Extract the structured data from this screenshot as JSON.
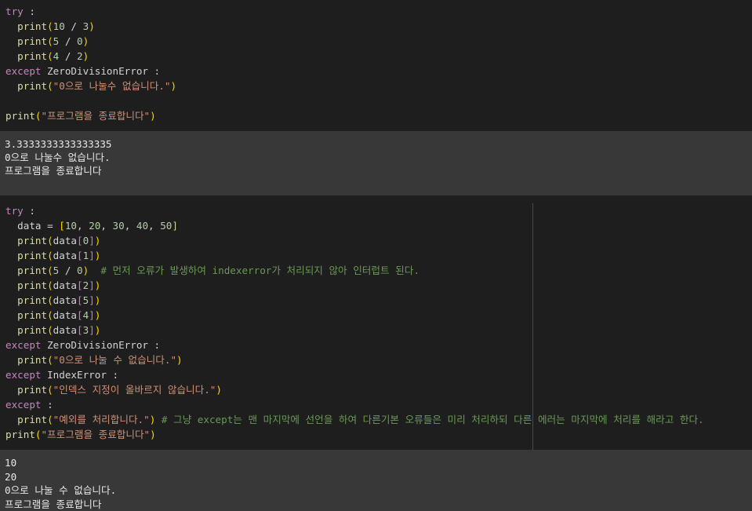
{
  "cell1": {
    "code": [
      [
        {
          "t": "try",
          "c": "kw"
        },
        {
          "t": " :",
          "c": "pl"
        }
      ],
      [
        {
          "t": "  print",
          "c": "fn"
        },
        {
          "t": "(",
          "c": "br"
        },
        {
          "t": "10",
          "c": "num"
        },
        {
          "t": " / ",
          "c": "pl"
        },
        {
          "t": "3",
          "c": "num"
        },
        {
          "t": ")",
          "c": "br"
        }
      ],
      [
        {
          "t": "  print",
          "c": "fn"
        },
        {
          "t": "(",
          "c": "br"
        },
        {
          "t": "5",
          "c": "num"
        },
        {
          "t": " / ",
          "c": "pl"
        },
        {
          "t": "0",
          "c": "num"
        },
        {
          "t": ")",
          "c": "br"
        }
      ],
      [
        {
          "t": "  print",
          "c": "fn"
        },
        {
          "t": "(",
          "c": "br"
        },
        {
          "t": "4",
          "c": "num"
        },
        {
          "t": " / ",
          "c": "pl"
        },
        {
          "t": "2",
          "c": "num"
        },
        {
          "t": ")",
          "c": "br"
        }
      ],
      [
        {
          "t": "except",
          "c": "kw"
        },
        {
          "t": " ZeroDivisionError :",
          "c": "pl"
        }
      ],
      [
        {
          "t": "  print",
          "c": "fn"
        },
        {
          "t": "(",
          "c": "br"
        },
        {
          "t": "\"0으로 나눌수 없습니다.\"",
          "c": "str"
        },
        {
          "t": ")",
          "c": "br"
        }
      ],
      [],
      [
        {
          "t": "print",
          "c": "fn"
        },
        {
          "t": "(",
          "c": "br"
        },
        {
          "t": "\"프로그램을 종료합니다\"",
          "c": "str"
        },
        {
          "t": ")",
          "c": "br"
        }
      ]
    ],
    "output": [
      "3.3333333333333335",
      "0으로 나눌수 없습니다.",
      "프로그램을 종료합니다"
    ]
  },
  "cell2": {
    "code": [
      [
        {
          "t": "try",
          "c": "kw"
        },
        {
          "t": " :",
          "c": "pl"
        }
      ],
      [
        {
          "t": "  data = ",
          "c": "pl"
        },
        {
          "t": "[",
          "c": "br"
        },
        {
          "t": "10",
          "c": "num"
        },
        {
          "t": ", ",
          "c": "pl"
        },
        {
          "t": "20",
          "c": "num"
        },
        {
          "t": ", ",
          "c": "pl"
        },
        {
          "t": "30",
          "c": "num"
        },
        {
          "t": ", ",
          "c": "pl"
        },
        {
          "t": "40",
          "c": "num"
        },
        {
          "t": ", ",
          "c": "pl"
        },
        {
          "t": "50",
          "c": "num"
        },
        {
          "t": "]",
          "c": "br"
        }
      ],
      [
        {
          "t": "  print",
          "c": "fn"
        },
        {
          "t": "(",
          "c": "br"
        },
        {
          "t": "data",
          "c": "pl"
        },
        {
          "t": "[",
          "c": "br2"
        },
        {
          "t": "0",
          "c": "num"
        },
        {
          "t": "]",
          "c": "br2"
        },
        {
          "t": ")",
          "c": "br"
        }
      ],
      [
        {
          "t": "  print",
          "c": "fn"
        },
        {
          "t": "(",
          "c": "br"
        },
        {
          "t": "data",
          "c": "pl"
        },
        {
          "t": "[",
          "c": "br2"
        },
        {
          "t": "1",
          "c": "num"
        },
        {
          "t": "]",
          "c": "br2"
        },
        {
          "t": ")",
          "c": "br"
        }
      ],
      [
        {
          "t": "  print",
          "c": "fn"
        },
        {
          "t": "(",
          "c": "br"
        },
        {
          "t": "5",
          "c": "num"
        },
        {
          "t": " / ",
          "c": "pl"
        },
        {
          "t": "0",
          "c": "num"
        },
        {
          "t": ")",
          "c": "br"
        },
        {
          "t": "  # 먼저 오류가 발생하여 indexerror가 처리되지 않아 인터럽트 된다.",
          "c": "cm"
        }
      ],
      [
        {
          "t": "  print",
          "c": "fn"
        },
        {
          "t": "(",
          "c": "br"
        },
        {
          "t": "data",
          "c": "pl"
        },
        {
          "t": "[",
          "c": "br2"
        },
        {
          "t": "2",
          "c": "num"
        },
        {
          "t": "]",
          "c": "br2"
        },
        {
          "t": ")",
          "c": "br"
        }
      ],
      [
        {
          "t": "  print",
          "c": "fn"
        },
        {
          "t": "(",
          "c": "br"
        },
        {
          "t": "data",
          "c": "pl"
        },
        {
          "t": "[",
          "c": "br2"
        },
        {
          "t": "5",
          "c": "num"
        },
        {
          "t": "]",
          "c": "br2"
        },
        {
          "t": ")",
          "c": "br"
        }
      ],
      [
        {
          "t": "  print",
          "c": "fn"
        },
        {
          "t": "(",
          "c": "br"
        },
        {
          "t": "data",
          "c": "pl"
        },
        {
          "t": "[",
          "c": "br2"
        },
        {
          "t": "4",
          "c": "num"
        },
        {
          "t": "]",
          "c": "br2"
        },
        {
          "t": ")",
          "c": "br"
        }
      ],
      [
        {
          "t": "  print",
          "c": "fn"
        },
        {
          "t": "(",
          "c": "br"
        },
        {
          "t": "data",
          "c": "pl"
        },
        {
          "t": "[",
          "c": "br2"
        },
        {
          "t": "3",
          "c": "num"
        },
        {
          "t": "]",
          "c": "br2"
        },
        {
          "t": ")",
          "c": "br"
        }
      ],
      [
        {
          "t": "except",
          "c": "kw"
        },
        {
          "t": " ZeroDivisionError :",
          "c": "pl"
        }
      ],
      [
        {
          "t": "  print",
          "c": "fn"
        },
        {
          "t": "(",
          "c": "br"
        },
        {
          "t": "\"0으로 나눌 수 없습니다.\"",
          "c": "str"
        },
        {
          "t": ")",
          "c": "br"
        }
      ],
      [
        {
          "t": "except",
          "c": "kw"
        },
        {
          "t": " IndexError :",
          "c": "pl"
        }
      ],
      [
        {
          "t": "  print",
          "c": "fn"
        },
        {
          "t": "(",
          "c": "br"
        },
        {
          "t": "\"인덱스 지정이 올바르지 않습니다.\"",
          "c": "str"
        },
        {
          "t": ")",
          "c": "br"
        }
      ],
      [
        {
          "t": "except",
          "c": "kw"
        },
        {
          "t": " :",
          "c": "pl"
        }
      ],
      [
        {
          "t": "  print",
          "c": "fn"
        },
        {
          "t": "(",
          "c": "br"
        },
        {
          "t": "\"예외를 처리합니다.\"",
          "c": "str"
        },
        {
          "t": ")",
          "c": "br"
        },
        {
          "t": " # 그냥 except는 맨 마지막에 선언을 하여 다른기본 오류들은 미리 처리하되 다른 에러는 마지막에 처리를 해라고 한다.",
          "c": "cm"
        }
      ],
      [
        {
          "t": "print",
          "c": "fn"
        },
        {
          "t": "(",
          "c": "br"
        },
        {
          "t": "\"프로그램을 종료합니다\"",
          "c": "str"
        },
        {
          "t": ")",
          "c": "br"
        }
      ]
    ],
    "output": [
      "10",
      "20",
      "0으로 나눌 수 없습니다.",
      "프로그램을 종료합니다"
    ]
  }
}
